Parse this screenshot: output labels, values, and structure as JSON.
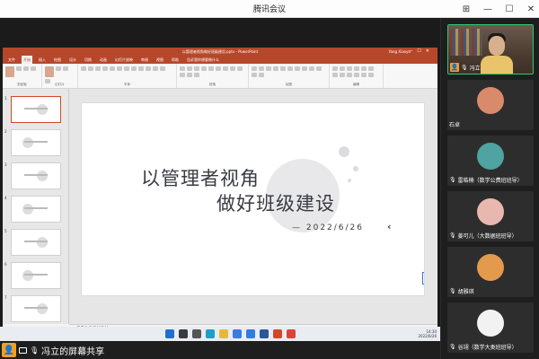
{
  "app": {
    "title": "腾讯会议"
  },
  "window_controls": {
    "pin": "⊞",
    "minimize": "—",
    "maximize": "☐",
    "close": "✕"
  },
  "powerpoint": {
    "file_title": "以管理者视角做好班级建设.pptx - PowerPoint",
    "user": "Yang Xiaoyu",
    "tabs": [
      "文件",
      "开始",
      "插入",
      "绘图",
      "设计",
      "切换",
      "动画",
      "幻灯片放映",
      "审阅",
      "视图",
      "帮助",
      "告诉我你想要做什么"
    ],
    "active_tab_index": 1,
    "ribbon_groups": [
      "剪贴板",
      "幻灯片",
      "字体",
      "段落",
      "绘图",
      "编辑"
    ],
    "slide": {
      "line1": "以管理者视角",
      "line2": "做好班级建设",
      "date": "— 2022/6/26",
      "arrow": "‹",
      "corner_label": "页"
    },
    "thumb_numbers": [
      "1",
      "2",
      "3",
      "4",
      "5",
      "6",
      "7"
    ],
    "notes_placeholder": "单击此处添加备注",
    "status_left": "幻灯片 第 1 张，共 12 张  中文(中国)",
    "zoom": "91%"
  },
  "taskbar": {
    "time": "14:30",
    "date": "2022/6/26"
  },
  "bottom": {
    "share_label": "冯立的屏幕共享"
  },
  "participants": [
    {
      "name": "冯立",
      "has_video": true,
      "host": true
    },
    {
      "name": "石卓",
      "avatar_color": "#d98a6a"
    },
    {
      "name": "雷皓楠（数学公费班班导）",
      "avatar_color": "#4fa3a0"
    },
    {
      "name": "姜可儿（大数据班班导）",
      "avatar_color": "#e8b8b0"
    },
    {
      "name": "胡雅琪",
      "avatar_color": "#e39a4c"
    },
    {
      "name": "谷翊（数学大类班班导）",
      "avatar_color": "#f2f2f2"
    }
  ],
  "colors": {
    "ppt_accent": "#b7472a",
    "active_speaker": "#2ecc71",
    "host_badge": "#f0a020"
  }
}
